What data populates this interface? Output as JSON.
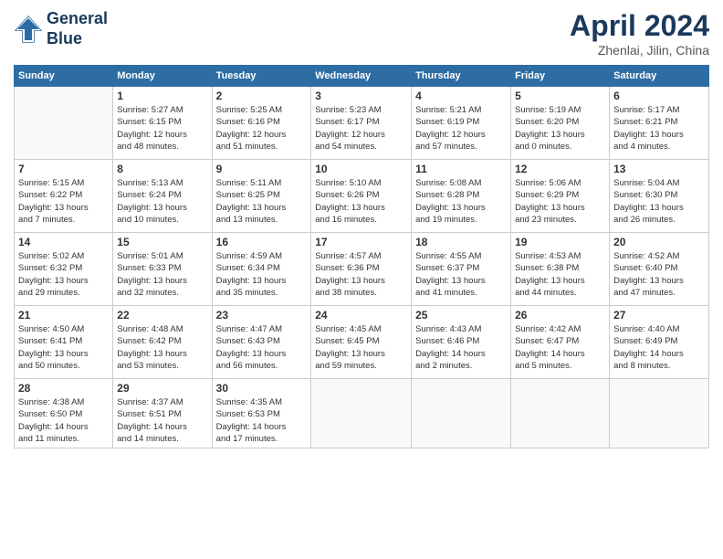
{
  "header": {
    "logo_line1": "General",
    "logo_line2": "Blue",
    "month_title": "April 2024",
    "location": "Zhenlai, Jilin, China"
  },
  "days_of_week": [
    "Sunday",
    "Monday",
    "Tuesday",
    "Wednesday",
    "Thursday",
    "Friday",
    "Saturday"
  ],
  "weeks": [
    [
      {
        "num": "",
        "info": ""
      },
      {
        "num": "1",
        "info": "Sunrise: 5:27 AM\nSunset: 6:15 PM\nDaylight: 12 hours\nand 48 minutes."
      },
      {
        "num": "2",
        "info": "Sunrise: 5:25 AM\nSunset: 6:16 PM\nDaylight: 12 hours\nand 51 minutes."
      },
      {
        "num": "3",
        "info": "Sunrise: 5:23 AM\nSunset: 6:17 PM\nDaylight: 12 hours\nand 54 minutes."
      },
      {
        "num": "4",
        "info": "Sunrise: 5:21 AM\nSunset: 6:19 PM\nDaylight: 12 hours\nand 57 minutes."
      },
      {
        "num": "5",
        "info": "Sunrise: 5:19 AM\nSunset: 6:20 PM\nDaylight: 13 hours\nand 0 minutes."
      },
      {
        "num": "6",
        "info": "Sunrise: 5:17 AM\nSunset: 6:21 PM\nDaylight: 13 hours\nand 4 minutes."
      }
    ],
    [
      {
        "num": "7",
        "info": "Sunrise: 5:15 AM\nSunset: 6:22 PM\nDaylight: 13 hours\nand 7 minutes."
      },
      {
        "num": "8",
        "info": "Sunrise: 5:13 AM\nSunset: 6:24 PM\nDaylight: 13 hours\nand 10 minutes."
      },
      {
        "num": "9",
        "info": "Sunrise: 5:11 AM\nSunset: 6:25 PM\nDaylight: 13 hours\nand 13 minutes."
      },
      {
        "num": "10",
        "info": "Sunrise: 5:10 AM\nSunset: 6:26 PM\nDaylight: 13 hours\nand 16 minutes."
      },
      {
        "num": "11",
        "info": "Sunrise: 5:08 AM\nSunset: 6:28 PM\nDaylight: 13 hours\nand 19 minutes."
      },
      {
        "num": "12",
        "info": "Sunrise: 5:06 AM\nSunset: 6:29 PM\nDaylight: 13 hours\nand 23 minutes."
      },
      {
        "num": "13",
        "info": "Sunrise: 5:04 AM\nSunset: 6:30 PM\nDaylight: 13 hours\nand 26 minutes."
      }
    ],
    [
      {
        "num": "14",
        "info": "Sunrise: 5:02 AM\nSunset: 6:32 PM\nDaylight: 13 hours\nand 29 minutes."
      },
      {
        "num": "15",
        "info": "Sunrise: 5:01 AM\nSunset: 6:33 PM\nDaylight: 13 hours\nand 32 minutes."
      },
      {
        "num": "16",
        "info": "Sunrise: 4:59 AM\nSunset: 6:34 PM\nDaylight: 13 hours\nand 35 minutes."
      },
      {
        "num": "17",
        "info": "Sunrise: 4:57 AM\nSunset: 6:36 PM\nDaylight: 13 hours\nand 38 minutes."
      },
      {
        "num": "18",
        "info": "Sunrise: 4:55 AM\nSunset: 6:37 PM\nDaylight: 13 hours\nand 41 minutes."
      },
      {
        "num": "19",
        "info": "Sunrise: 4:53 AM\nSunset: 6:38 PM\nDaylight: 13 hours\nand 44 minutes."
      },
      {
        "num": "20",
        "info": "Sunrise: 4:52 AM\nSunset: 6:40 PM\nDaylight: 13 hours\nand 47 minutes."
      }
    ],
    [
      {
        "num": "21",
        "info": "Sunrise: 4:50 AM\nSunset: 6:41 PM\nDaylight: 13 hours\nand 50 minutes."
      },
      {
        "num": "22",
        "info": "Sunrise: 4:48 AM\nSunset: 6:42 PM\nDaylight: 13 hours\nand 53 minutes."
      },
      {
        "num": "23",
        "info": "Sunrise: 4:47 AM\nSunset: 6:43 PM\nDaylight: 13 hours\nand 56 minutes."
      },
      {
        "num": "24",
        "info": "Sunrise: 4:45 AM\nSunset: 6:45 PM\nDaylight: 13 hours\nand 59 minutes."
      },
      {
        "num": "25",
        "info": "Sunrise: 4:43 AM\nSunset: 6:46 PM\nDaylight: 14 hours\nand 2 minutes."
      },
      {
        "num": "26",
        "info": "Sunrise: 4:42 AM\nSunset: 6:47 PM\nDaylight: 14 hours\nand 5 minutes."
      },
      {
        "num": "27",
        "info": "Sunrise: 4:40 AM\nSunset: 6:49 PM\nDaylight: 14 hours\nand 8 minutes."
      }
    ],
    [
      {
        "num": "28",
        "info": "Sunrise: 4:38 AM\nSunset: 6:50 PM\nDaylight: 14 hours\nand 11 minutes."
      },
      {
        "num": "29",
        "info": "Sunrise: 4:37 AM\nSunset: 6:51 PM\nDaylight: 14 hours\nand 14 minutes."
      },
      {
        "num": "30",
        "info": "Sunrise: 4:35 AM\nSunset: 6:53 PM\nDaylight: 14 hours\nand 17 minutes."
      },
      {
        "num": "",
        "info": ""
      },
      {
        "num": "",
        "info": ""
      },
      {
        "num": "",
        "info": ""
      },
      {
        "num": "",
        "info": ""
      }
    ]
  ]
}
